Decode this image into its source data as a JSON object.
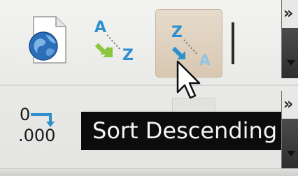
{
  "toolbar": {
    "tools": [
      {
        "name": "web-document",
        "icon": "globe-document-icon"
      },
      {
        "name": "sort-ascending",
        "icon": "sort-ascending-icon",
        "glyph_top": "A",
        "glyph_bottom": "Z"
      },
      {
        "name": "sort-descending",
        "icon": "sort-descending-icon",
        "glyph_top": "Z",
        "glyph_bottom": "A",
        "state": "hovered"
      }
    ],
    "overflow_label": "»",
    "row2": {
      "format_top": "0",
      "format_bottom": ".000",
      "overflow_label": "»"
    }
  },
  "tooltip": {
    "text": "Sort Descending"
  },
  "colors": {
    "sort_letter_blue": "#2f8fcf",
    "sort_arrow_green": "#8cc63f",
    "hover_bg": "#d8c8b2",
    "tooltip_bg": "#0c0c0c"
  }
}
